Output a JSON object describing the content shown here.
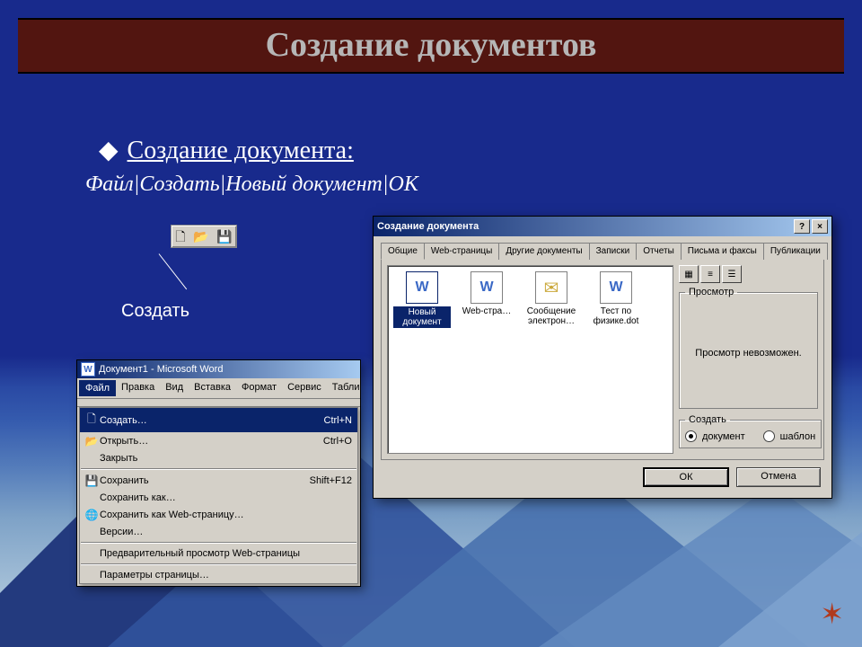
{
  "slide": {
    "title": "Создание документов",
    "bullet_heading": "Создание документа:",
    "bullet_path": "Файл|Создать|Новый документ|ОК",
    "create_label": "Создать"
  },
  "mini_toolbar": {
    "new_icon": "🗋",
    "open_icon": "📂",
    "save_icon": "💾"
  },
  "word": {
    "title": "Документ1 - Microsoft Word",
    "menu": {
      "file": "Файл",
      "edit": "Правка",
      "view": "Вид",
      "insert": "Вставка",
      "format": "Формат",
      "tools": "Сервис",
      "table": "Табли"
    },
    "file_menu": {
      "create": {
        "label": "Создать…",
        "shortcut": "Ctrl+N"
      },
      "open": {
        "label": "Открыть…",
        "shortcut": "Ctrl+O"
      },
      "close": {
        "label": "Закрыть"
      },
      "save": {
        "label": "Сохранить",
        "shortcut": "Shift+F12"
      },
      "save_as": {
        "label": "Сохранить как…"
      },
      "save_as_web": {
        "label": "Сохранить как Web-страницу…"
      },
      "versions": {
        "label": "Версии…"
      },
      "web_preview": {
        "label": "Предварительный просмотр Web-страницы"
      },
      "page_setup": {
        "label": "Параметры страницы…"
      }
    }
  },
  "dialog": {
    "title": "Создание документа",
    "help_btn": "?",
    "close_btn": "×",
    "tabs": {
      "general": "Общие",
      "web": "Web-страницы",
      "other": "Другие документы",
      "notes": "Записки",
      "reports": "Отчеты",
      "letters": "Письма и факсы",
      "publications": "Публикации"
    },
    "templates": {
      "new_doc": "Новый документ",
      "web_page": "Web-стра…",
      "email": "Сообщение электрон…",
      "test": "Тест по физике.dot"
    },
    "preview_legend": "Просмотр",
    "preview_text": "Просмотр невозможен.",
    "create_legend": "Создать",
    "radio_document": "документ",
    "radio_template": "шаблон",
    "ok": "ОК",
    "cancel": "Отмена"
  }
}
